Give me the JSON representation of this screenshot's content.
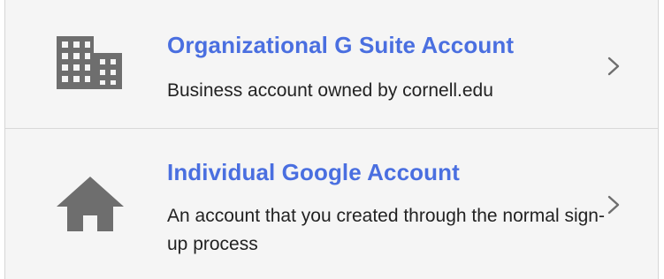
{
  "accounts": [
    {
      "title": "Organizational G Suite Account",
      "description": "Business account owned by cornell.edu",
      "icon": "building-icon"
    },
    {
      "title": "Individual Google Account",
      "description": "An account that you created through the normal sign-up process",
      "icon": "home-icon"
    }
  ],
  "colors": {
    "title": "#4a6fe0",
    "icon": "#6e6e6e",
    "background": "#f5f5f5"
  }
}
